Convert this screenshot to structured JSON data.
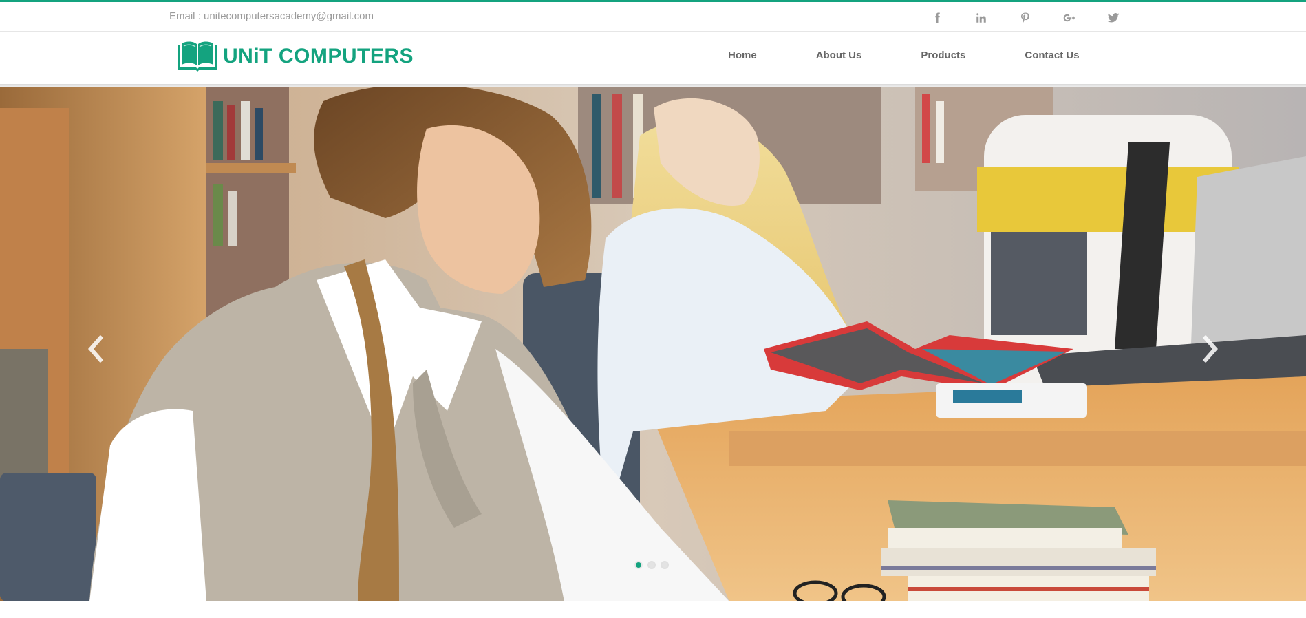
{
  "topbar": {
    "email_text": "Email : unitecomputersacademy@gmail.com",
    "socials": [
      {
        "icon": "facebook-icon"
      },
      {
        "icon": "linkedin-icon"
      },
      {
        "icon": "pinterest-icon"
      },
      {
        "icon": "google-plus-icon"
      },
      {
        "icon": "twitter-icon"
      }
    ]
  },
  "brand": {
    "name": "UNiT COMPUTERS",
    "logo_icon": "open-book-icon",
    "color": "#14a37f"
  },
  "nav": {
    "items": [
      {
        "label": "Home"
      },
      {
        "label": "About Us"
      },
      {
        "label": "Products"
      },
      {
        "label": "Contact Us"
      }
    ]
  },
  "slider": {
    "prev_icon": "chevron-left-icon",
    "next_icon": "chevron-right-icon",
    "slide_count": 3,
    "active_slide": 1,
    "image_description_icon": "students-reading-photo"
  }
}
